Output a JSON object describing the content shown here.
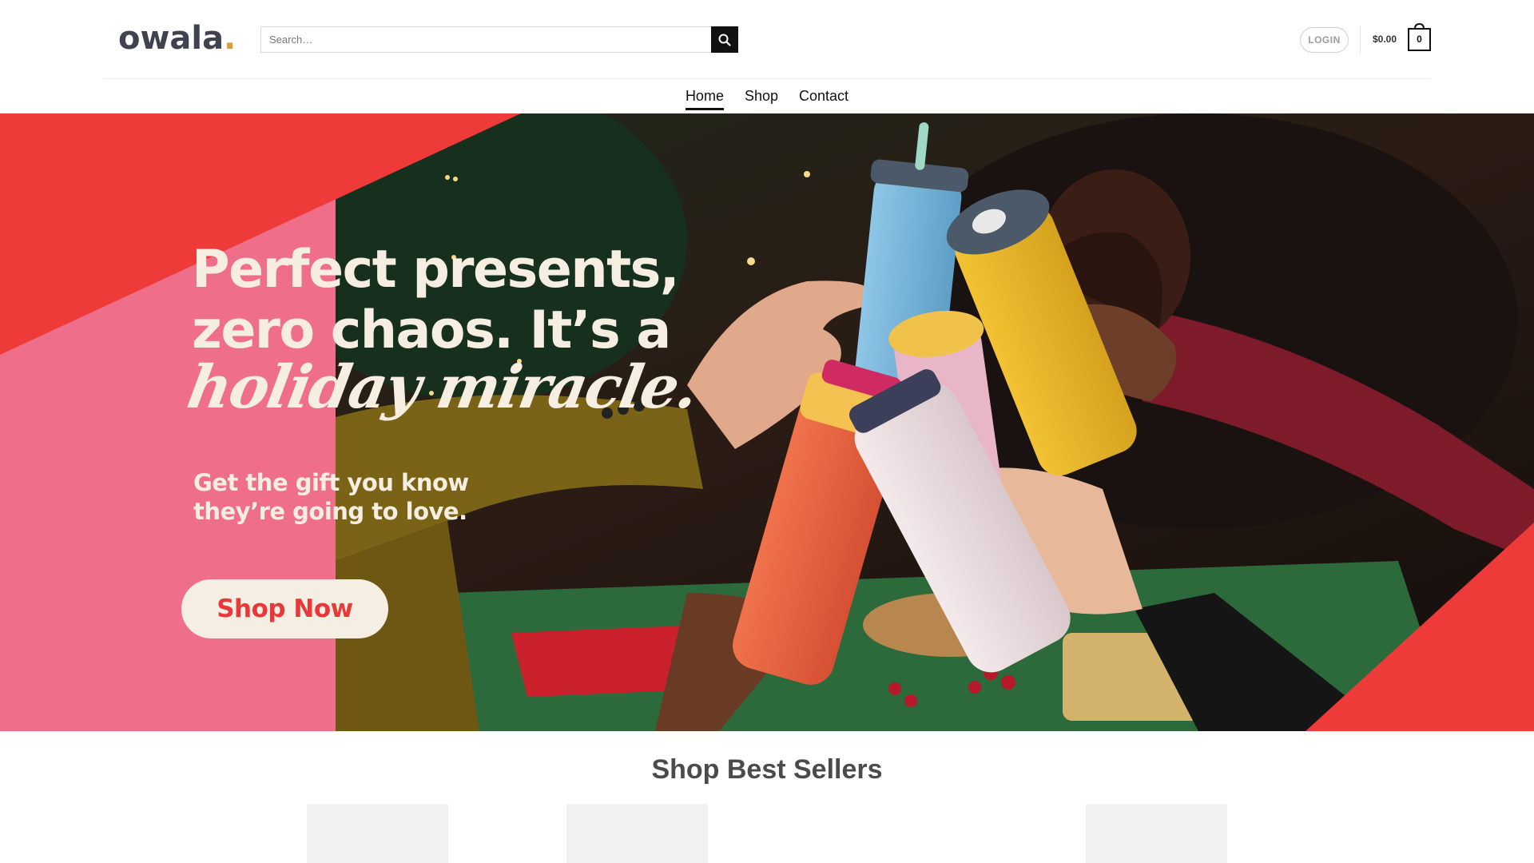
{
  "header": {
    "logo_text": "owala",
    "logo_dot": ".",
    "search_placeholder": "Search…",
    "search_icon": "search-icon",
    "login_label": "LOGIN",
    "cart_total": "$0.00",
    "cart_count": "0",
    "cart_icon": "shopping-bag-icon"
  },
  "nav": {
    "items": [
      {
        "label": "Home",
        "active": true
      },
      {
        "label": "Shop",
        "active": false
      },
      {
        "label": "Contact",
        "active": false
      }
    ]
  },
  "hero": {
    "headline_line1": "Perfect presents,",
    "headline_line2": "zero chaos. It’s a",
    "headline_script": "holiday miracle.",
    "sub_line1": "Get the gift you know",
    "sub_line2": "they’re going to love.",
    "cta_label": "Shop Now"
  },
  "best_sellers": {
    "title": "Shop Best Sellers"
  },
  "colors": {
    "accent_red": "#e8383a",
    "pink": "#ef6f8a",
    "cream": "#f6efe1",
    "logo_gold": "#d3a13a"
  }
}
